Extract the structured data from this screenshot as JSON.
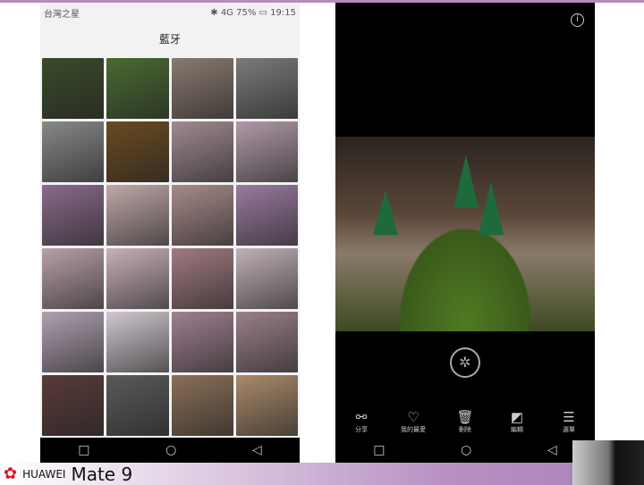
{
  "left_phone": {
    "status": {
      "carrier": "台灣之星",
      "battery": "75%",
      "time": "19:15",
      "network": "4G"
    },
    "title": "藍牙",
    "tiles": [
      "#3a4a2a",
      "#4a6a30",
      "#8a7a70",
      "#7a7a7a",
      "#888",
      "#6a4a20",
      "#a08a90",
      "#b09aa8",
      "#8a6a8a",
      "#c0a8a8",
      "#a88a8a",
      "#9a7aa0",
      "#b8a0a8",
      "#c8b0b8",
      "#a07a80",
      "#c0b0b8",
      "#b0a0b0",
      "#d0c8d0",
      "#a08090",
      "#9a8088",
      "#5a3a3a",
      "#5a5a5a",
      "#8a7058",
      "#aa8a6a"
    ]
  },
  "right_phone": {
    "actions": [
      {
        "icon": "share-icon",
        "label": "分享"
      },
      {
        "icon": "heart-icon",
        "label": "我的最愛"
      },
      {
        "icon": "trash-icon",
        "label": "刪除"
      },
      {
        "icon": "edit-icon",
        "label": "編輯"
      },
      {
        "icon": "menu-icon",
        "label": "選單"
      }
    ]
  },
  "footer": {
    "brand": "HUAWEI",
    "model": "Mate 9"
  }
}
